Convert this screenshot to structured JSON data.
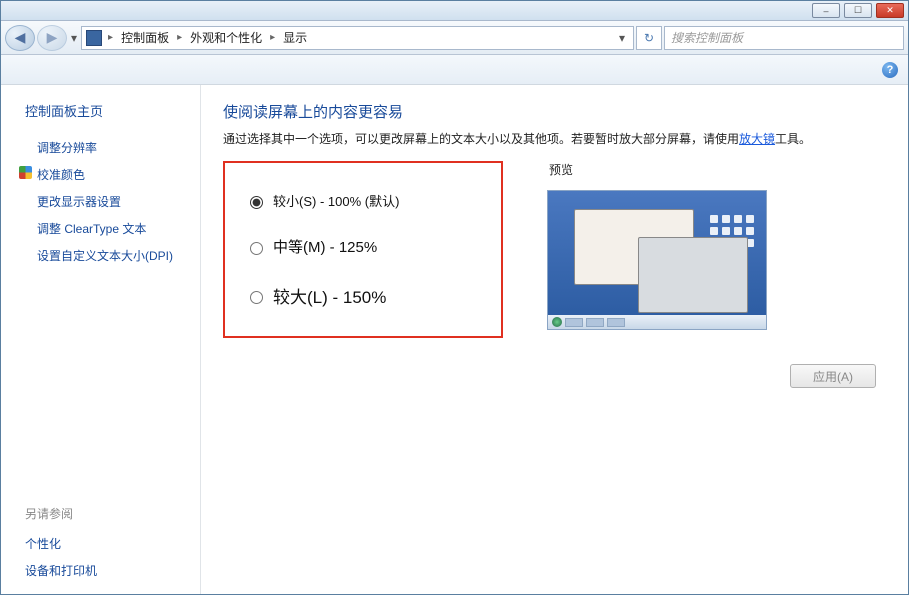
{
  "window": {
    "min_symbol": "–",
    "max_symbol": "☐",
    "close_symbol": "✕"
  },
  "nav": {
    "back_symbol": "◀",
    "fwd_symbol": "▶",
    "dropdown_symbol": "▾",
    "refresh_symbol": "↻",
    "breadcrumb_sep": "▸",
    "crumb1": "控制面板",
    "crumb2": "外观和个性化",
    "crumb3": "显示",
    "search_placeholder": "搜索控制面板"
  },
  "help_symbol": "?",
  "sidebar": {
    "title": "控制面板主页",
    "links": [
      {
        "label": "调整分辨率",
        "shield": false
      },
      {
        "label": "校准颜色",
        "shield": true
      },
      {
        "label": "更改显示器设置",
        "shield": false
      },
      {
        "label": "调整 ClearType 文本",
        "shield": false
      },
      {
        "label": "设置自定义文本大小(DPI)",
        "shield": false
      }
    ],
    "see_also": "另请参阅",
    "footer_links": [
      "个性化",
      "设备和打印机"
    ]
  },
  "main": {
    "title": "使阅读屏幕上的内容更容易",
    "desc_pre": "通过选择其中一个选项，可以更改屏幕上的文本大小以及其他项。若要暂时放大部分屏幕，请使用",
    "desc_link": "放大镜",
    "desc_post": "工具。",
    "radios": {
      "small": "较小(S) - 100% (默认)",
      "medium": "中等(M) - 125%",
      "large": "较大(L) - 150%"
    },
    "preview_label": "预览",
    "apply_label": "应用(A)"
  }
}
